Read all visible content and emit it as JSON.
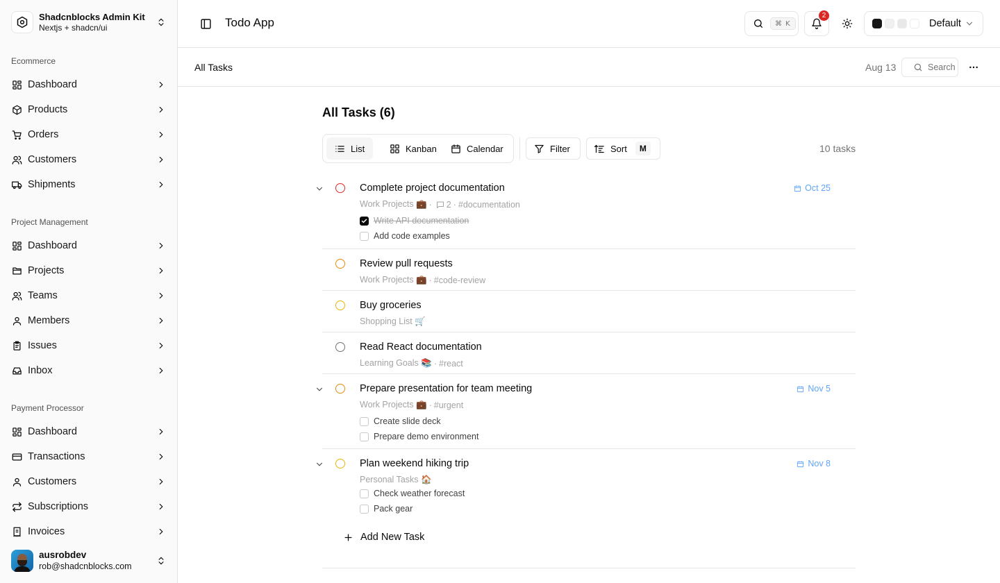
{
  "sidebar": {
    "brand": {
      "title": "Shadcnblocks Admin Kit",
      "subtitle": "Nextjs + shadcn/ui",
      "icon": "settings-logo-icon"
    },
    "groups": [
      {
        "label": "Ecommerce",
        "items": [
          {
            "label": "Dashboard",
            "icon": "dashboard-icon"
          },
          {
            "label": "Products",
            "icon": "package-icon"
          },
          {
            "label": "Orders",
            "icon": "cart-icon"
          },
          {
            "label": "Customers",
            "icon": "users-icon"
          },
          {
            "label": "Shipments",
            "icon": "truck-icon"
          }
        ]
      },
      {
        "label": "Project Management",
        "items": [
          {
            "label": "Dashboard",
            "icon": "dashboard-icon"
          },
          {
            "label": "Projects",
            "icon": "folder-icon"
          },
          {
            "label": "Teams",
            "icon": "users-icon"
          },
          {
            "label": "Members",
            "icon": "user-icon"
          },
          {
            "label": "Issues",
            "icon": "clipboard-icon"
          },
          {
            "label": "Inbox",
            "icon": "inbox-icon"
          }
        ]
      },
      {
        "label": "Payment Processor",
        "items": [
          {
            "label": "Dashboard",
            "icon": "dashboard-icon"
          },
          {
            "label": "Transactions",
            "icon": "credit-card-icon"
          },
          {
            "label": "Customers",
            "icon": "user-icon"
          },
          {
            "label": "Subscriptions",
            "icon": "repeat-icon"
          },
          {
            "label": "Invoices",
            "icon": "receipt-icon"
          }
        ]
      }
    ],
    "user": {
      "name": "ausrobdev",
      "email": "rob@shadcnblocks.com"
    }
  },
  "header": {
    "title": "Todo App",
    "search_shortcut": "⌘ K",
    "notification_count": "2",
    "theme": {
      "label": "Default",
      "swatches": [
        "#171717",
        "#f0f0f0",
        "#e8e8e8",
        "#ffffff"
      ]
    }
  },
  "subheader": {
    "title": "All Tasks",
    "date": "Aug 13",
    "search_label": "Search"
  },
  "main": {
    "heading": "All Tasks (6)",
    "views": {
      "list": "List",
      "kanban": "Kanban",
      "calendar": "Calendar"
    },
    "filter_label": "Filter",
    "sort_label": "Sort",
    "sort_key": "M",
    "task_count": "10 tasks",
    "add_label": "Add New Task",
    "tasks": [
      {
        "title": "Complete project documentation",
        "project": "Work Projects 💼",
        "comments": "2",
        "tag": "#documentation",
        "due": "Oct 25",
        "status_color": "#dc2626",
        "subtasks": [
          {
            "label": "Write API documentation",
            "done": true
          },
          {
            "label": "Add code examples",
            "done": false
          }
        ]
      },
      {
        "title": "Review pull requests",
        "project": "Work Projects 💼",
        "tag": "#code-review",
        "status_color": "#ea8a0c"
      },
      {
        "title": "Buy groceries",
        "project": "Shopping List 🛒",
        "status_color": "#eab308"
      },
      {
        "title": "Read React documentation",
        "project": "Learning Goals 📚",
        "tag": "#react",
        "status_color": "#737373"
      },
      {
        "title": "Prepare presentation for team meeting",
        "project": "Work Projects 💼",
        "tag": "#urgent",
        "due": "Nov 5",
        "status_color": "#ea8a0c",
        "subtasks": [
          {
            "label": "Create slide deck",
            "done": false
          },
          {
            "label": "Prepare demo environment",
            "done": false
          }
        ]
      },
      {
        "title": "Plan weekend hiking trip",
        "project": "Personal Tasks 🏠",
        "due": "Nov 8",
        "status_color": "#eab308",
        "subtasks": [
          {
            "label": "Check weather forecast",
            "done": false
          },
          {
            "label": "Pack gear",
            "done": false
          }
        ]
      }
    ]
  },
  "colors": {
    "accent_due": "#60a5fa",
    "badge": "#dc2626",
    "border": "#e5e5e5",
    "muted": "#737373"
  }
}
